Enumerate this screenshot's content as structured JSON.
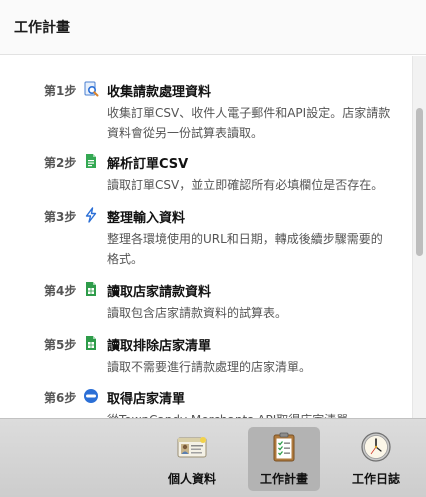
{
  "header": {
    "title": "工作計畫"
  },
  "steps": [
    {
      "no": "第1步",
      "title": "收集請款處理資料",
      "desc": "收集訂單CSV、收件人電子郵件和API設定。店家請款資料會從另一份試算表讀取。",
      "icon": "search-document-icon"
    },
    {
      "no": "第2步",
      "title": "解析訂單CSV",
      "desc": "讀取訂單CSV，並立即確認所有必填欄位是否存在。",
      "icon": "csv-file-icon"
    },
    {
      "no": "第3步",
      "title": "整理輸入資料",
      "desc": "整理各環境使用的URL和日期，轉成後續步驟需要的格式。",
      "icon": "lightning-icon"
    },
    {
      "no": "第4步",
      "title": "讀取店家請款資料",
      "desc": "讀取包含店家請款資料的試算表。",
      "icon": "spreadsheet-icon"
    },
    {
      "no": "第5步",
      "title": "讀取排除店家清單",
      "desc": "讀取不需要進行請款處理的店家清單。",
      "icon": "spreadsheet-icon"
    },
    {
      "no": "第6步",
      "title": "取得店家清單",
      "desc": "從TownCandy Merchants API取得店家清單。",
      "icon": "api-icon"
    }
  ],
  "tabs": [
    {
      "label": "個人資料",
      "icon": "id-card-icon",
      "active": false
    },
    {
      "label": "工作計畫",
      "icon": "clipboard-icon",
      "active": true
    },
    {
      "label": "工作日誌",
      "icon": "clock-icon",
      "active": false
    }
  ],
  "colors": {
    "accent": "#2b6fd6",
    "sheet": "#2e9c4a",
    "active_tab": "#b3b3b3"
  }
}
